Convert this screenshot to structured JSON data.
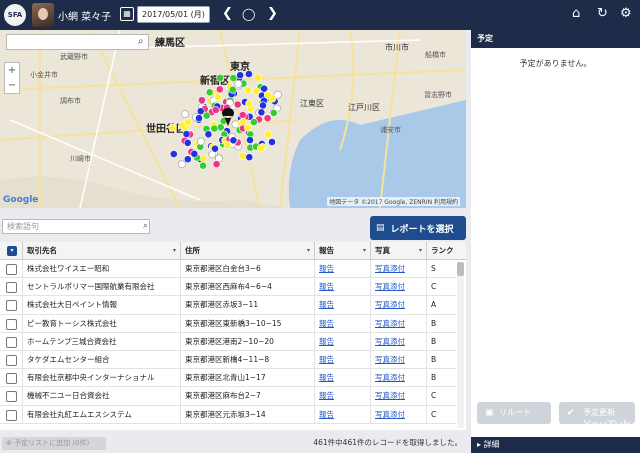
{
  "header": {
    "logo_text": "SFA",
    "user_name": "小網 菜々子",
    "date": "2017/05/01 (月)",
    "prev_icon": "chevron-left-icon",
    "today_icon": "circle-icon",
    "next_icon": "chevron-right-icon",
    "icons": [
      "calendar-icon",
      "home-icon",
      "refresh-icon",
      "gear-icon"
    ]
  },
  "map": {
    "labels": {
      "nerima": "練馬区",
      "tokyo": "東京",
      "shinjuku": "新宿区",
      "setagaya": "世田谷区",
      "edogawa": "江戸川区",
      "koto": "江東区",
      "ichikawa": "市川市",
      "musashino": "武蔵野市",
      "chofu": "調布市",
      "kawasaki": "川崎市",
      "urayasu": "浦安市",
      "funabashi": "船橋市",
      "narashino": "習志野市",
      "koganei": "小金井市"
    },
    "credit": "地図データ ©2017 Google, ZENRIN 利用規約",
    "google_logo": "Google",
    "zoom_in": "+",
    "zoom_out": "−",
    "marker_colors": [
      "#ffee33",
      "#33cc33",
      "#2233dd",
      "#ee3388",
      "#ffffff"
    ]
  },
  "search": {
    "placeholder": "検索語句"
  },
  "report_select_label": "レポートを選択",
  "table": {
    "columns": [
      "取引先名",
      "住所",
      "報告",
      "写真",
      "ランク"
    ],
    "rows": [
      {
        "name": "株式会社ワイスエー昭和",
        "address": "東京都港区白金台3−6",
        "report": "報告",
        "photo": "写真添付",
        "rank": "S"
      },
      {
        "name": "セントラルポリマー国際航業有限会社",
        "address": "東京都港区西麻布4−6−4",
        "report": "報告",
        "photo": "写真添付",
        "rank": "C"
      },
      {
        "name": "株式会社大日ペイント情報",
        "address": "東京都港区赤坂3−11",
        "report": "報告",
        "photo": "写真添付",
        "rank": "A"
      },
      {
        "name": "ピー教育トーシス株式会社",
        "address": "東京都港区東新橋3−10−15",
        "report": "報告",
        "photo": "写真添付",
        "rank": "B"
      },
      {
        "name": "ホームテンプ三城合資会社",
        "address": "東京都港区港南2−10−20",
        "report": "報告",
        "photo": "写真添付",
        "rank": "B"
      },
      {
        "name": "タケダエムセンター組合",
        "address": "東京都港区新橋4−11−8",
        "report": "報告",
        "photo": "写真添付",
        "rank": "B"
      },
      {
        "name": "有限会社京都中央インターナショナル",
        "address": "東京都港区北青山1−17",
        "report": "報告",
        "photo": "写真添付",
        "rank": "B"
      },
      {
        "name": "機械不二ユー日合資会社",
        "address": "東京都港区麻布台2−7",
        "report": "報告",
        "photo": "写真添付",
        "rank": "C"
      },
      {
        "name": "有限会社丸紅エムエスシステム",
        "address": "東京都港区元赤坂3−14",
        "report": "報告",
        "photo": "写真添付",
        "rank": "C"
      }
    ]
  },
  "footer": {
    "add_to_list": "予定リストに追加 (0件)",
    "record_count": "461件中461件のレコードを取得しました。"
  },
  "right_panel": {
    "title": "予定",
    "empty_message": "予定がありません。",
    "release_button": "リルート",
    "update_button": "予定更新",
    "details_label": "詳細"
  },
  "watermark": "YouTube"
}
